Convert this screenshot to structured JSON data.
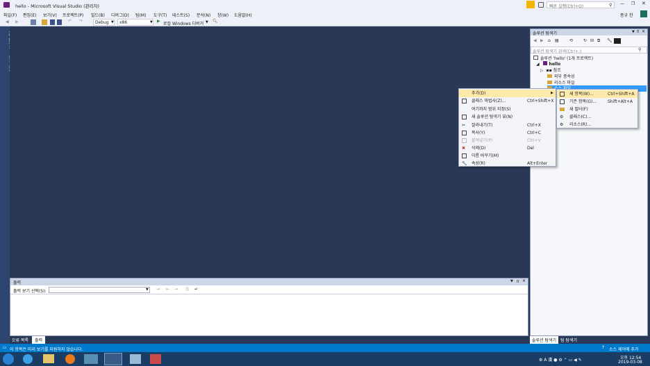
{
  "window": {
    "title": "hello - Microsoft Visual Studio (관리자)",
    "quick_launch_placeholder": "빠른 실행(Ctrl+Q)",
    "user": "종규 한"
  },
  "menu": [
    "파일(F)",
    "편집(E)",
    "보기(V)",
    "프로젝트(P)",
    "빌드(B)",
    "디버그(D)",
    "팀(M)",
    "도구(T)",
    "테스트(S)",
    "분석(N)",
    "창(W)",
    "도움말(H)"
  ],
  "toolbar": {
    "config": "Debug",
    "platform": "x86",
    "run_label": "로컬 Windows 디버거"
  },
  "left_tabs": [
    "서버 탐색기",
    "도구 상자"
  ],
  "output": {
    "title": "출력",
    "source_label": "출력 보기 선택(S):",
    "source_value": ""
  },
  "solution": {
    "title": "솔루션 탐색기",
    "search_placeholder": "솔루션 탐색기 검색(Ctrl+;)",
    "tree": [
      "솔루션 'hello' (1개 프로젝트)",
      "hello",
      "참조",
      "외부 종속성",
      "리소스 파일",
      "소스 파일"
    ]
  },
  "context_menu": {
    "items": [
      {
        "label": "추가(D)",
        "shortcut": "",
        "submenu": true
      },
      {
        "label": "클래스 마법사(Z)...",
        "shortcut": "Ctrl+Shift+X"
      },
      {
        "label": "여기까지 범위 지정(S)",
        "shortcut": ""
      },
      {
        "label": "새 솔루션 탐색기 뷰(N)",
        "shortcut": ""
      },
      {
        "label": "잘라내기(T)",
        "shortcut": "Ctrl+X"
      },
      {
        "label": "복사(Y)",
        "shortcut": "Ctrl+C"
      },
      {
        "label": "붙여넣기(P)",
        "shortcut": "Ctrl+V"
      },
      {
        "label": "삭제(D)",
        "shortcut": "Del"
      },
      {
        "label": "이름 바꾸기(M)",
        "shortcut": ""
      },
      {
        "label": "속성(R)",
        "shortcut": "Alt+Enter"
      }
    ]
  },
  "submenu": {
    "items": [
      {
        "label": "새 항목(W)...",
        "shortcut": "Ctrl+Shift+A"
      },
      {
        "label": "기존 항목(G)...",
        "shortcut": "Shift+Alt+A"
      },
      {
        "label": "새 필터(F)",
        "shortcut": ""
      },
      {
        "label": "클래스(C)...",
        "shortcut": ""
      },
      {
        "label": "리소스(R)...",
        "shortcut": ""
      }
    ]
  },
  "bottom_tabs": {
    "left": [
      "오류 목록",
      "출력"
    ],
    "right": [
      "솔루션 탐색기",
      "팀 탐색기"
    ]
  },
  "status": {
    "message": "이 항목은 미리 보기를 지원하지 않습니다.",
    "source_control": "소스 제어에 추가"
  },
  "clock": {
    "time": "오후 12:54",
    "date": "2019-03-08"
  },
  "colors": {
    "accent": "#007acc",
    "vs_purple": "#68217a",
    "highlight": "#fde9a9"
  }
}
